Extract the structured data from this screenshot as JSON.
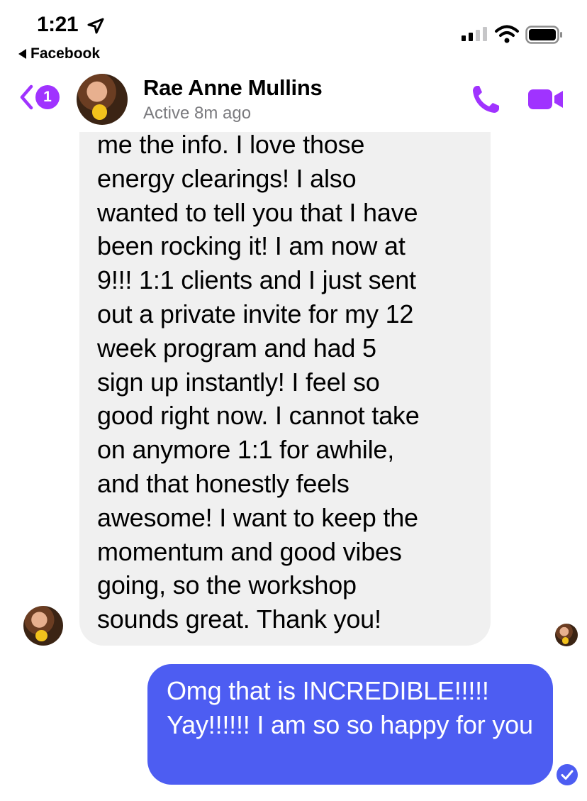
{
  "status_bar": {
    "time": "1:21",
    "back_app_label": "Facebook"
  },
  "header": {
    "unread_count": "1",
    "contact_name": "Rae Anne Mullins",
    "contact_status": "Active 8m ago",
    "accent_color": "#a033ff"
  },
  "messages": {
    "incoming": "me the info. I love those\nenergy clearings! I also\nwanted to tell you that I have\nbeen rocking it! I am now at\n9!!! 1:1 clients and I just sent\nout a private invite for my 12\nweek program and had 5\nsign up instantly! I feel so\ngood right now. I cannot take\non anymore 1:1 for awhile,\nand that honestly feels\nawesome! I want to keep the\nmomentum and good vibes\ngoing, so the workshop\nsounds great. Thank you!",
    "outgoing": "Omg that is INCREDIBLE!!!!! Yay!!!!!! I am so so happy for you",
    "outgoing_color": "#4d5df2"
  },
  "icons": {
    "location": "location-arrow-icon",
    "signal": "cellular-signal-icon",
    "wifi": "wifi-icon",
    "battery": "battery-icon",
    "back": "chevron-left-icon",
    "call": "phone-icon",
    "video": "video-camera-icon",
    "delivered": "checkmark-circle-icon"
  }
}
